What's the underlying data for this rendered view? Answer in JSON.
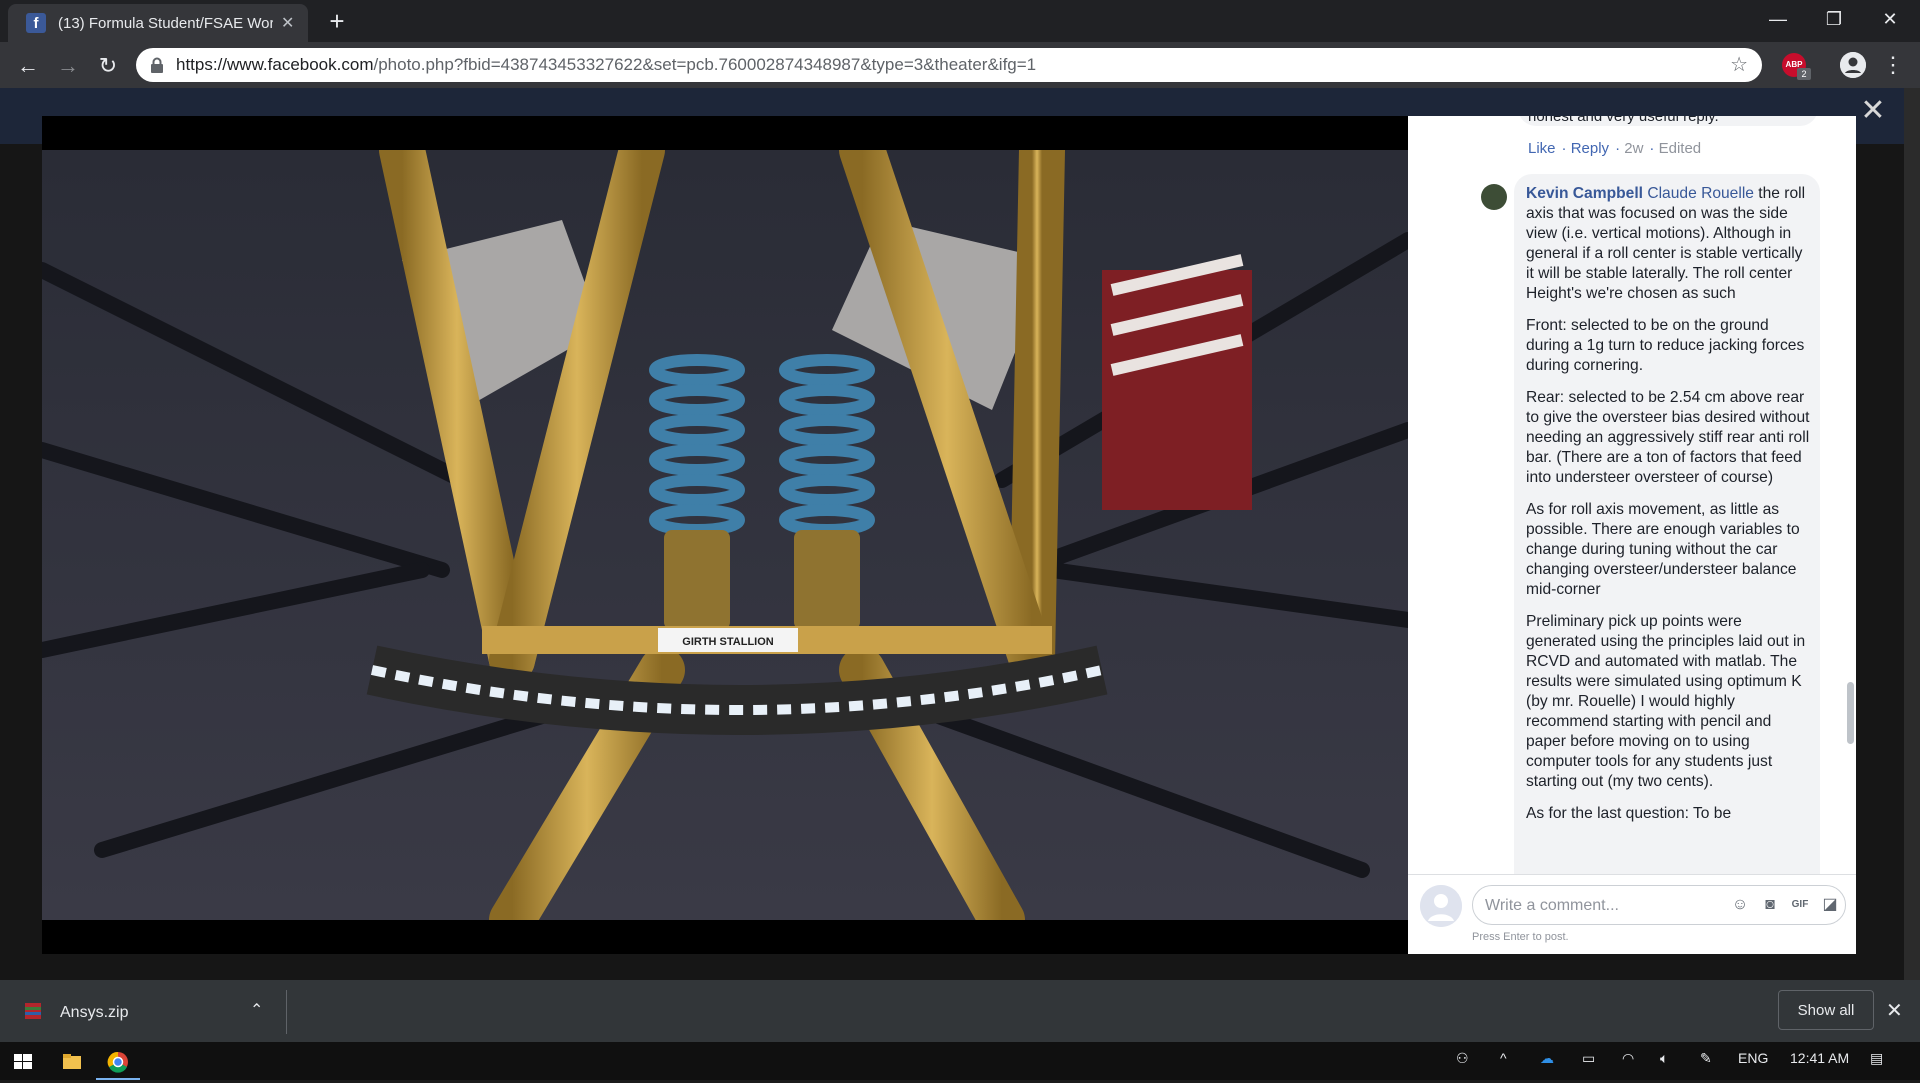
{
  "browser": {
    "tab_title": "(13) Formula Student/FSAE Worl",
    "tab_favicon": "f",
    "url_prefix": "https://www.facebook.com",
    "url_rest": "/photo.php?fbid=438743453327622&set=pcb.760002874348987&type=3&theater&ifg=1",
    "extension_badge": "ABP",
    "extension_count": "2"
  },
  "comments": {
    "previous": {
      "text_fragment": "honest and very useful reply.",
      "actions": [
        "Like",
        "Reply"
      ],
      "time": "2w",
      "edited": "Edited"
    },
    "reply": {
      "author": "Kevin Campbell",
      "mention": "Claude Rouelle",
      "paragraphs": [
        " the roll axis that was focused on was the side view (i.e. vertical motions). Although in general if a roll center is stable vertically it will be stable laterally. The roll center Height's we're chosen as such",
        "Front: selected to be on the ground during a 1g turn to reduce jacking forces during cornering.",
        "Rear: selected to be 2.54 cm above rear to give the oversteer bias desired without needing an aggressively stiff rear anti roll bar. (There are a ton of factors that feed into understeer oversteer of course)",
        "As for roll axis movement, as little as possible. There are enough variables to change during tuning without the car changing oversteer/understeer balance mid-corner",
        "Preliminary pick up points were generated using the principles laid out in RCVD and automated with matlab. The results were simulated using optimum K (by mr. Rouelle) I would highly recommend starting with pencil and paper before moving on to using computer tools for any students just starting out (my two cents).",
        "As for the last question: To be"
      ]
    },
    "composer_placeholder": "Write a comment...",
    "composer_hint": "Press Enter to post."
  },
  "photo": {
    "label_text": "GIRTH STALLION"
  },
  "downloads": {
    "file": "Ansys.zip",
    "show_all": "Show all"
  },
  "taskbar": {
    "language": "ENG",
    "time": "12:41 AM"
  }
}
